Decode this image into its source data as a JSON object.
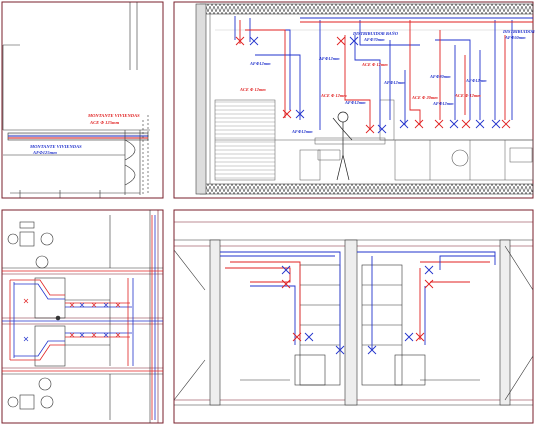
{
  "colors": {
    "frame": "#7a1f2b",
    "line": "#333333",
    "hot": "#e02020",
    "cold": "#2233cc",
    "hatch": "#888888"
  },
  "labels": {
    "montante_viviendas_1": "MONTANTE VIVIENDAS",
    "ace_125": "ACE Φ 125mm",
    "montante_viviendas_2": "MONTANTE VIVIENDAS",
    "af_125": "AFΦ125mm",
    "distribuidor_bano": "DISTRIBUIDOR BAÑO",
    "af_70_bano": "AFΦ70mm",
    "distribuidor_2": "DISTRIBUIDOR",
    "af_50_dist": "AFΦ50mm",
    "af_12_a": "AFΦ12mm",
    "ace_12_a": "ACE Φ 12mm",
    "af_12_b": "AFΦ12mm",
    "af_12_c": "AFΦ12mm",
    "ace_12_b": "ACE Φ 12mm",
    "ace_12_c": "ACE Φ 12mm",
    "af_12_d": "AFΦ12mm",
    "af_12_e": "AFΦ12mm",
    "af_20": "AFΦ20mm",
    "af_12_f": "AFΦ12mm",
    "ace_20": "ACE Φ 20mm",
    "af_12_g": "AFΦ12mm",
    "ace_12_d": "ACE Φ 12mm"
  }
}
